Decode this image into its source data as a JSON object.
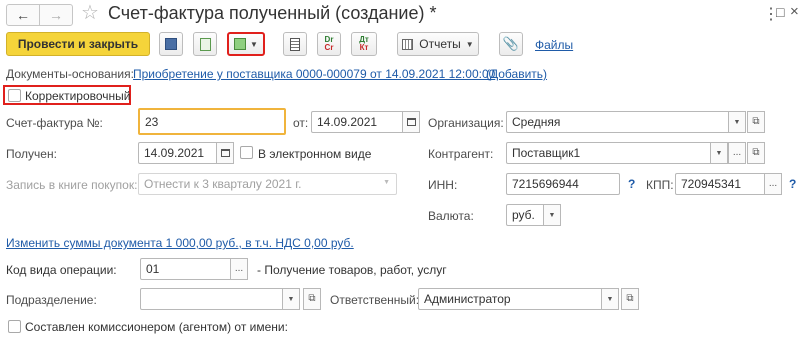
{
  "window": {
    "title": "Счет-фактура полученный (создание) *"
  },
  "toolbar": {
    "post_close_label": "Провести и закрыть",
    "reports_label": "Отчеты",
    "files_label": "Файлы",
    "dt_kt_label": "Дт Кт",
    "dr_cr_label": "Dr Cr"
  },
  "base_docs": {
    "label": "Документы-основания:",
    "link": "Приобретение у поставщика 0000-000079 от 14.09.2021 12:00:00",
    "add_label": "(Добавить)"
  },
  "corrective": {
    "label": "Корректировочный",
    "checked": false
  },
  "invoice": {
    "label": "Счет-фактура №:",
    "number": "23",
    "from_label": "от:",
    "date": "14.09.2021"
  },
  "received": {
    "label": "Получен:",
    "date": "14.09.2021",
    "electronic_label": "В электронном виде"
  },
  "purchase_book": {
    "label": "Запись в книге покупок:",
    "value": "Отнести к 3 кварталу 2021 г."
  },
  "org": {
    "label": "Организация:",
    "value": "Средняя"
  },
  "counterparty": {
    "label": "Контрагент:",
    "value": "Поставщик1"
  },
  "inn": {
    "label": "ИНН:",
    "value": "7215696944",
    "kpp_label": "КПП:",
    "kpp_value": "720945341",
    "help": "?"
  },
  "currency": {
    "label": "Валюта:",
    "value": "руб."
  },
  "change_sums_link": "Изменить суммы документа 1 000,00 руб., в т.ч. НДС 0,00 руб.",
  "operation": {
    "label": "Код вида операции:",
    "value": "01",
    "description": "- Получение товаров, работ, услуг"
  },
  "division": {
    "label": "Подразделение:",
    "value": ""
  },
  "responsible": {
    "label": "Ответственный:",
    "value": "Администратор"
  },
  "agent": {
    "label": "Составлен комиссионером (агентом) от имени:"
  },
  "colors": {
    "accent_yellow": "#f5d43a",
    "highlight_red": "#e0201c",
    "link_blue": "#1f5ba8",
    "focus_orange": "#f0b43c"
  }
}
